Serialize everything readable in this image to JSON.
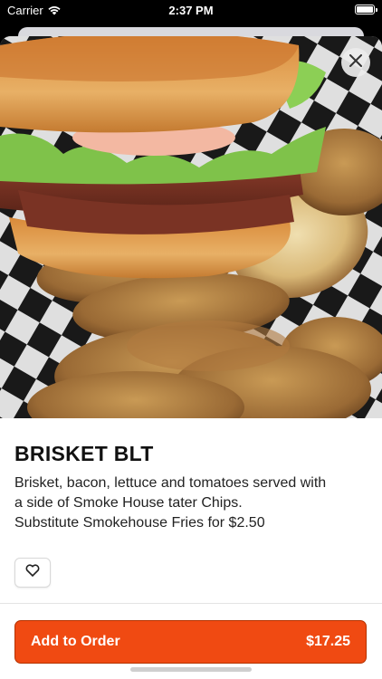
{
  "status_bar": {
    "carrier": "Carrier",
    "time": "2:37 PM"
  },
  "item": {
    "name": "BRISKET BLT",
    "description_lines": [
      "Brisket, bacon, lettuce and tomatoes served with",
      "a side of Smoke House tater Chips.",
      "Substitute Smokehouse Fries for $2.50"
    ],
    "image_icon": "brisket-blt-photo"
  },
  "actions": {
    "add_label": "Add to Order",
    "price": "$17.25"
  },
  "icons": {
    "close": "close-icon",
    "favorite": "heart-icon",
    "wifi": "wifi-icon",
    "battery": "battery-icon"
  },
  "colors": {
    "accent": "#f04a12",
    "accent_border": "#b43200",
    "text_primary": "#111111",
    "text_secondary": "#222222"
  }
}
